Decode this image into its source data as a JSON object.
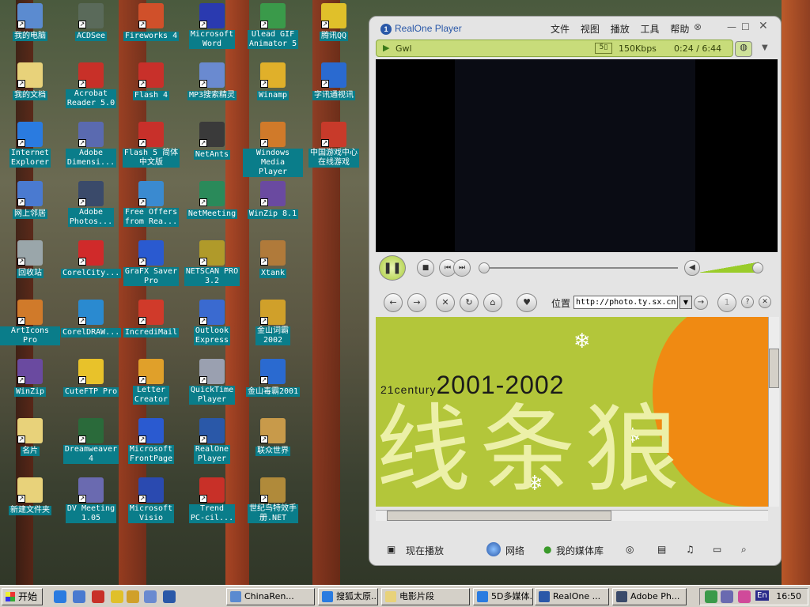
{
  "desktop_icons": [
    {
      "label": "我的电脑",
      "color": "#5b8bd0"
    },
    {
      "label": "我的文档",
      "color": "#e8d27a"
    },
    {
      "label": "Internet\nExplorer",
      "color": "#2a7be0"
    },
    {
      "label": "网上邻居",
      "color": "#4a7ad0"
    },
    {
      "label": "回收站",
      "color": "#9aa6aa"
    },
    {
      "label": "ArtIcons Pro",
      "color": "#d07a2a"
    },
    {
      "label": "WinZip",
      "color": "#6a4aa0"
    },
    {
      "label": "名片",
      "color": "#e8d27a"
    },
    {
      "label": "新建文件夹",
      "color": "#e8d27a"
    },
    {
      "label": "ACDSee",
      "color": "#5a6a5a"
    },
    {
      "label": "Acrobat\nReader 5.0",
      "color": "#c83028"
    },
    {
      "label": "Adobe\nDimensi...",
      "color": "#5a6ab0"
    },
    {
      "label": "Adobe\nPhotos...",
      "color": "#3a4a6a"
    },
    {
      "label": "CorelCity...",
      "color": "#d02a2a"
    },
    {
      "label": "CorelDRAW...",
      "color": "#2a8ad0"
    },
    {
      "label": "CuteFTP Pro",
      "color": "#e8c22a"
    },
    {
      "label": "Dreamweaver\n4",
      "color": "#2a6a3a"
    },
    {
      "label": "DV Meeting\n1.05",
      "color": "#6a6ab0"
    },
    {
      "label": "Fireworks 4",
      "color": "#d0502a"
    },
    {
      "label": "Flash 4",
      "color": "#c8302a"
    },
    {
      "label": "Flash 5 简体\n中文版",
      "color": "#c8302a"
    },
    {
      "label": "Free Offers\nfrom Rea...",
      "color": "#3a8ad0"
    },
    {
      "label": "GraFX Saver\nPro",
      "color": "#2a5ad0"
    },
    {
      "label": "IncrediMail",
      "color": "#d03a2a"
    },
    {
      "label": "Letter\nCreator",
      "color": "#e0a02a"
    },
    {
      "label": "Microsoft\nFrontPage",
      "color": "#2a5ad0"
    },
    {
      "label": "Microsoft\nVisio",
      "color": "#2a4ab0"
    },
    {
      "label": "Microsoft\nWord",
      "color": "#2a3ab0"
    },
    {
      "label": "MP3搜索精灵",
      "color": "#6a8ad0"
    },
    {
      "label": "NetAnts",
      "color": "#3a3a3a"
    },
    {
      "label": "NetMeeting",
      "color": "#2a8a5a"
    },
    {
      "label": "NETSCAN PRO\n3.2",
      "color": "#b09a2a"
    },
    {
      "label": "Outlook\nExpress",
      "color": "#3a6ad0"
    },
    {
      "label": "QuickTime\nPlayer",
      "color": "#9aa0b0"
    },
    {
      "label": "RealOne\nPlayer",
      "color": "#2a58a8"
    },
    {
      "label": "Trend\nPC-cil...",
      "color": "#c83028"
    },
    {
      "label": "Ulead GIF\nAnimator 5",
      "color": "#3a9a4a"
    },
    {
      "label": "Winamp",
      "color": "#e0b02a"
    },
    {
      "label": "Windows\nMedia Player",
      "color": "#d07a2a"
    },
    {
      "label": "WinZip 8.1",
      "color": "#6a4aa0"
    },
    {
      "label": "Xtank",
      "color": "#b07a3a"
    },
    {
      "label": "金山词霸\n2002",
      "color": "#d0a02a"
    },
    {
      "label": "金山毒霸2001",
      "color": "#2a6ad0"
    },
    {
      "label": "联众世界",
      "color": "#c89a4a"
    },
    {
      "label": "世纪鸟特效手\n册.NET",
      "color": "#b08a3a"
    },
    {
      "label": "腾讯QQ",
      "color": "#e0c02a"
    },
    {
      "label": "字讯通视讯",
      "color": "#2a6ad0"
    },
    {
      "label": "中国游戏中心\n在线游戏",
      "color": "#c83a2a"
    }
  ],
  "player": {
    "app_title": "RealOne Player",
    "menu": [
      "文件",
      "视图",
      "播放",
      "工具",
      "帮助"
    ],
    "clip_title": "Gwl",
    "bitrate": "150Kbps",
    "time": "0:24 / 6:44",
    "location_label": "位置",
    "url": "http://photo.ty.sx.cn",
    "web_century": "21century",
    "web_years": "2001-2002",
    "web_big_text": "线条狼",
    "bottom_tabs": [
      "现在播放",
      "网络",
      "我的媒体库"
    ]
  },
  "taskbar": {
    "start_label": "开始",
    "tasks": [
      {
        "label": "ChinaRen...",
        "color": "#5a8ad0"
      },
      {
        "label": "搜狐太原...",
        "color": "#2a7be0"
      },
      {
        "label": "电影片段",
        "color": "#e8d27a"
      },
      {
        "label": "5D多媒体...",
        "color": "#2a7be0"
      },
      {
        "label": "RealOne ...",
        "color": "#2a58a8"
      },
      {
        "label": "Adobe Ph...",
        "color": "#3a4a6a"
      }
    ],
    "clock": "16:50",
    "lang": "En"
  }
}
